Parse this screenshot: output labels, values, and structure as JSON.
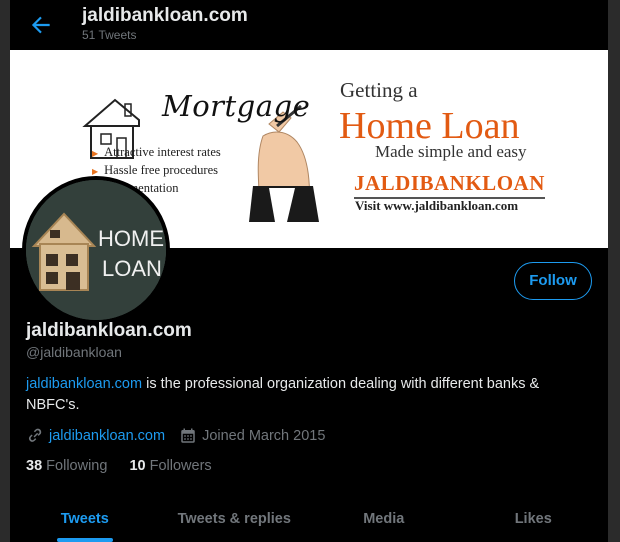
{
  "header": {
    "title": "jaldibankloan.com",
    "tweet_count": "51 Tweets"
  },
  "banner": {
    "mortgage": "Mortgage",
    "features": [
      "Attractive interest rates",
      "Hassle free procedures",
      "documentation"
    ],
    "getting": "Getting a",
    "home_loan": "Home Loan",
    "made_simple": "Made simple and easy",
    "brand": "JALDIBANKLOAN",
    "visit": "Visit www.jaldibankloan.com"
  },
  "avatar": {
    "line1": "HOME",
    "line2": "LOAN"
  },
  "profile": {
    "follow_label": "Follow",
    "name": "jaldibankloan.com",
    "handle": "@jaldibankloan",
    "bio_link": "jaldibankloan.com",
    "bio_text": " is the professional organization dealing with different banks & NBFC's.",
    "website": "jaldibankloan.com",
    "joined": "Joined March 2015",
    "following_count": "38",
    "following_label": "Following",
    "followers_count": "10",
    "followers_label": "Followers"
  },
  "tabs": [
    {
      "label": "Tweets",
      "active": true
    },
    {
      "label": "Tweets & replies",
      "active": false
    },
    {
      "label": "Media",
      "active": false
    },
    {
      "label": "Likes",
      "active": false
    }
  ],
  "colors": {
    "accent": "#1d9bf0",
    "background": "#000000",
    "banner_orange": "#e25a12"
  }
}
